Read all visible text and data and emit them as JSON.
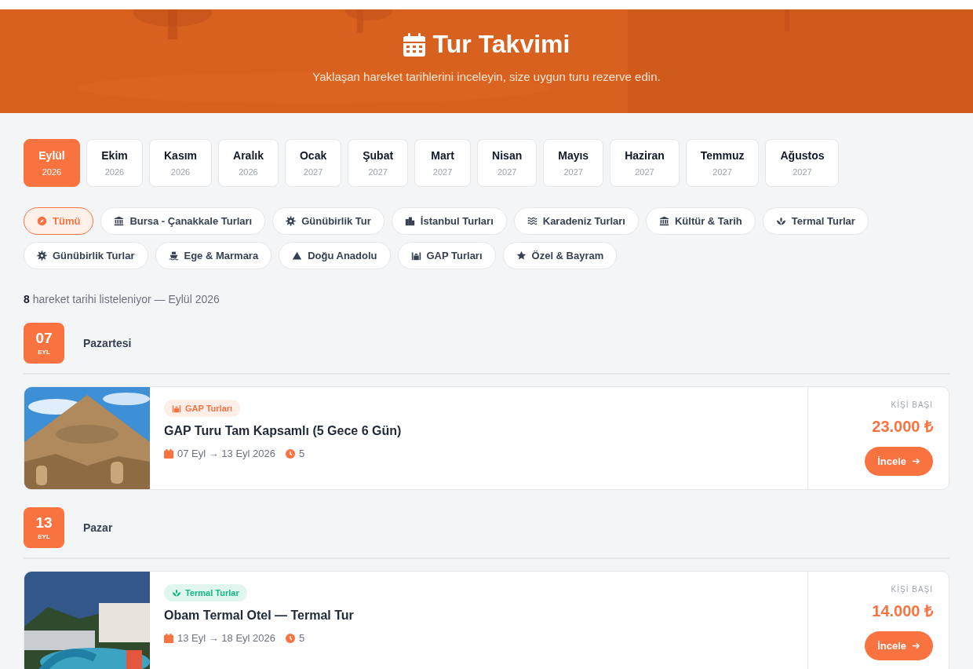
{
  "header": {
    "title": "Tur Takvimi",
    "subtitle": "Yaklaşan hareket tarihlerini inceleyin, size uygun turu rezerve edin."
  },
  "months": [
    {
      "name": "Eylül",
      "year": "2026",
      "selected": true
    },
    {
      "name": "Ekim",
      "year": "2026",
      "selected": false
    },
    {
      "name": "Kasım",
      "year": "2026",
      "selected": false
    },
    {
      "name": "Aralık",
      "year": "2026",
      "selected": false
    },
    {
      "name": "Ocak",
      "year": "2027",
      "selected": false
    },
    {
      "name": "Şubat",
      "year": "2027",
      "selected": false
    },
    {
      "name": "Mart",
      "year": "2027",
      "selected": false
    },
    {
      "name": "Nisan",
      "year": "2027",
      "selected": false
    },
    {
      "name": "Mayıs",
      "year": "2027",
      "selected": false
    },
    {
      "name": "Haziran",
      "year": "2027",
      "selected": false
    },
    {
      "name": "Temmuz",
      "year": "2027",
      "selected": false
    },
    {
      "name": "Ağustos",
      "year": "2027",
      "selected": false
    }
  ],
  "categories": [
    {
      "label": "Tümü",
      "selected": true
    },
    {
      "label": "Bursa - Çanakkale Turları",
      "selected": false
    },
    {
      "label": "Günübirlik Tur",
      "selected": false
    },
    {
      "label": "İstanbul Turları",
      "selected": false
    },
    {
      "label": "Karadeniz Turları",
      "selected": false
    },
    {
      "label": "Kültür & Tarih",
      "selected": false
    },
    {
      "label": "Termal Turlar",
      "selected": false
    },
    {
      "label": "Günübirlik Turlar",
      "selected": false
    },
    {
      "label": "Ege & Marmara",
      "selected": false
    },
    {
      "label": "Doğu Anadolu",
      "selected": false
    },
    {
      "label": "GAP Turları",
      "selected": false
    },
    {
      "label": "Özel & Bayram",
      "selected": false
    }
  ],
  "summary": {
    "count": "8",
    "text": "hareket tarihi listeleniyor — Eylül 2026"
  },
  "days": [
    {
      "day": "07",
      "month": "EYL",
      "weekday": "Pazartesi",
      "tours": [
        {
          "tag": "GAP Turları",
          "color": "#f97340",
          "title": "GAP Turu Tam Kapsamlı (5 Gece 6 Gün)",
          "dates": "07 Eyl → 13 Eyl 2026",
          "duration": "5",
          "price_label": "KİŞİ BAŞI",
          "price": "23.000 ₺",
          "button": "İncele"
        }
      ]
    },
    {
      "day": "13",
      "month": "EYL",
      "weekday": "Pazar",
      "tours": [
        {
          "tag": "Termal Turlar",
          "color": "#10b981",
          "title": "Obam Termal Otel — Termal Tur",
          "dates": "13 Eyl → 18 Eyl 2026",
          "duration": "5",
          "price_label": "KİŞİ BAŞI",
          "price": "14.000 ₺",
          "button": "İncele"
        }
      ]
    }
  ]
}
